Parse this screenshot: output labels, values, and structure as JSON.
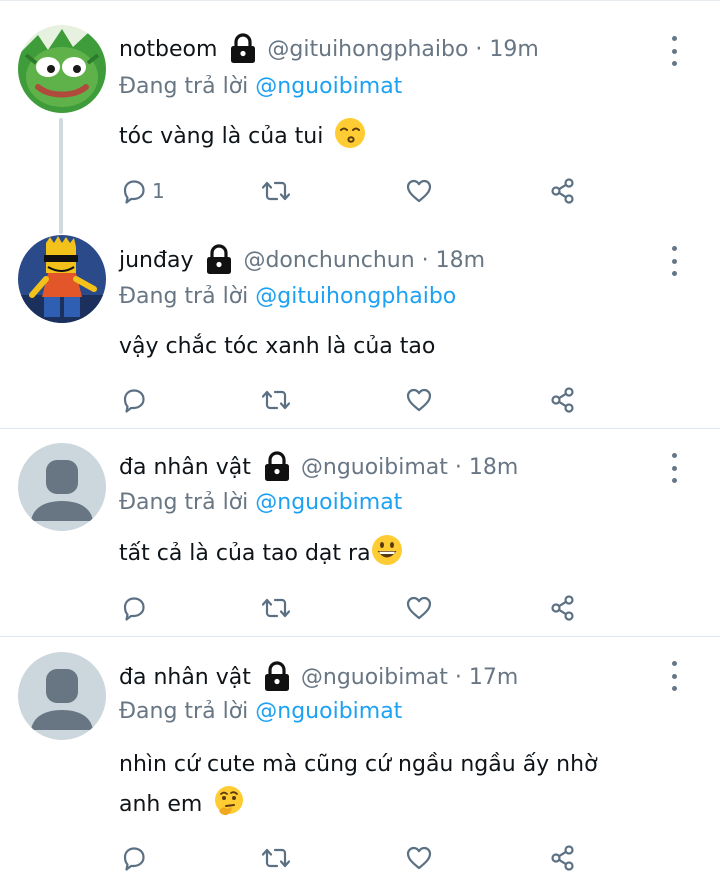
{
  "colors": {
    "text": "#0f1419",
    "muted": "#687684",
    "link": "#1da1f2",
    "divider": "#e1e8ed",
    "thread": "#cfd9de"
  },
  "tweets": [
    {
      "name": "notbeom",
      "handle": "@gituihongphaibo · 19m",
      "reply_prefix": "Đang trả lời",
      "reply_to": "@nguoibimat",
      "text": "tóc vàng là của tui",
      "emoji": "kissing-face",
      "reply_count": "1",
      "avatar": "frog-avatar"
    },
    {
      "name": "junđay",
      "handle": "@donchunchun · 18m",
      "reply_prefix": "Đang trả lời",
      "reply_to": "@gituihongphaibo",
      "text": "vậy chắc tóc xanh là của tao",
      "reply_count": "",
      "avatar": "cartoon-avatar"
    },
    {
      "name": "đa nhân vật",
      "handle": "@nguoibimat · 18m",
      "reply_prefix": "Đang trả lời",
      "reply_to": "@nguoibimat",
      "text": "tất cả là của tao dạt ra",
      "emoji": "grinning-face",
      "reply_count": "",
      "avatar": "default-avatar"
    },
    {
      "name": "đa nhân vật",
      "handle": "@nguoibimat · 17m",
      "reply_prefix": "Đang trả lời",
      "reply_to": "@nguoibimat",
      "text_line1": "nhìn cứ cute mà cũng cứ ngầu ngầu ấy nhờ",
      "text_line2": "anh em",
      "emoji": "thinking-face",
      "reply_count": "",
      "avatar": "default-avatar"
    }
  ],
  "icons": {
    "lock": "lock-icon",
    "more": "more-vertical-icon",
    "reply": "reply-icon",
    "retweet": "retweet-icon",
    "like": "heart-icon",
    "share": "share-icon"
  }
}
